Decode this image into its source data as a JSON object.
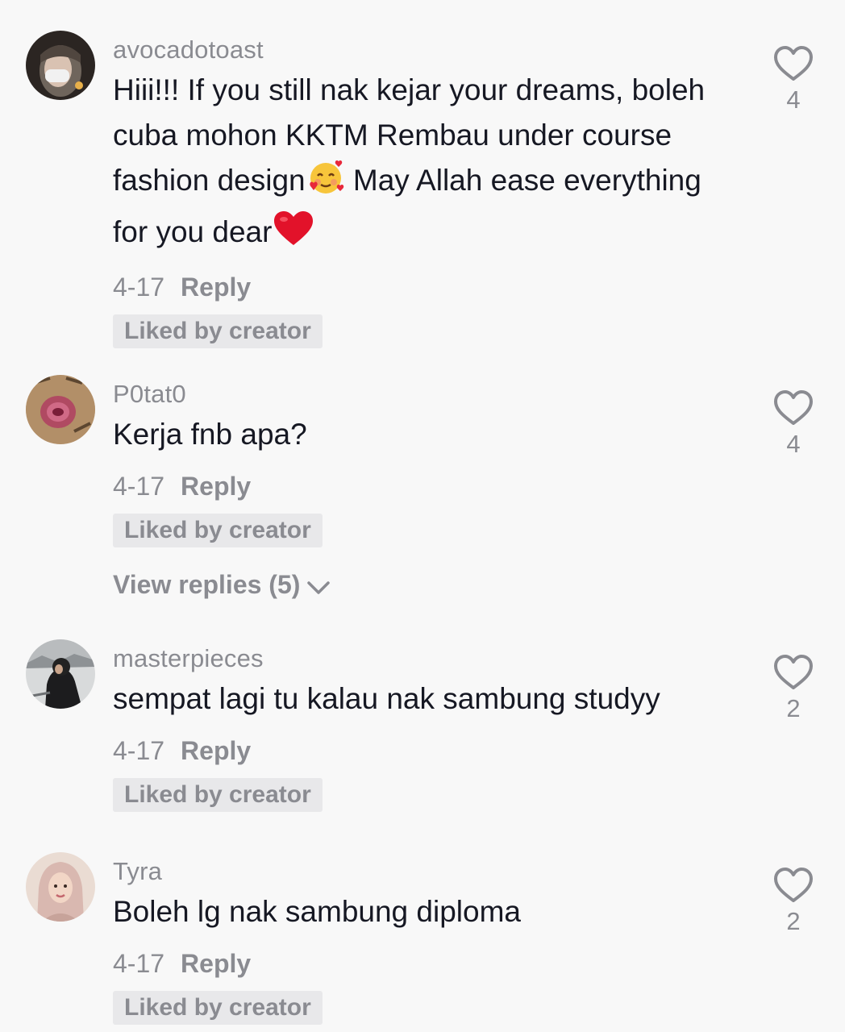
{
  "comments": [
    {
      "username": "avocadotoast",
      "text_line1": "Hiii!!! If you still nak kejar your dreams, boleh cuba mohon KKTM Rembau under course fashion design",
      "emoji1": "🥰",
      "text_line2": " May Allah ease everything for you dear",
      "emoji2": "❤️",
      "date": "4-17",
      "reply_label": "Reply",
      "liked_tag": "Liked by creator",
      "likes": "4"
    },
    {
      "username": "P0tat0",
      "text": "Kerja fnb apa?",
      "date": "4-17",
      "reply_label": "Reply",
      "liked_tag": "Liked by creator",
      "view_replies": "View replies (5)",
      "likes": "4"
    },
    {
      "username": "masterpieces",
      "text": "sempat lagi tu kalau nak sambung studyy",
      "date": "4-17",
      "reply_label": "Reply",
      "liked_tag": "Liked by creator",
      "likes": "2"
    },
    {
      "username": "Tyra",
      "text": "Boleh lg nak sambung diploma",
      "date": "4-17",
      "reply_label": "Reply",
      "liked_tag": "Liked by creator",
      "likes": "2"
    }
  ],
  "icons": {
    "like": "heart-outline-icon",
    "expand": "chevron-down-icon",
    "emoji_smiling_hearts": "smiling-face-with-hearts-emoji",
    "emoji_red_heart": "red-heart-emoji"
  },
  "colors": {
    "background": "#f8f8f8",
    "primary_text": "#161823",
    "secondary_text": "#8a8b91",
    "tag_background": "#e8e8ea"
  }
}
